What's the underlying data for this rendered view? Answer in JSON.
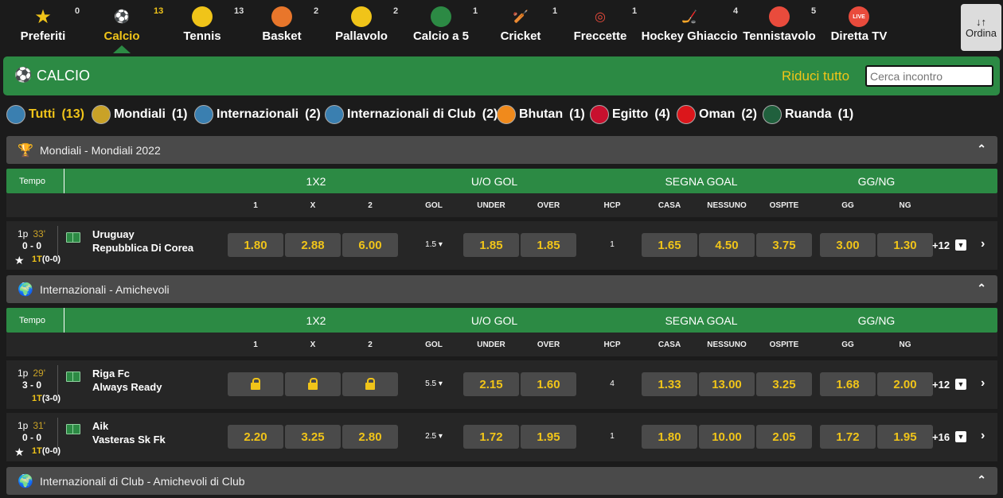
{
  "nav": {
    "sports": [
      {
        "label": "Preferiti",
        "count": "0",
        "icon": "star-icon",
        "color": "#f0c419",
        "glyph": "★"
      },
      {
        "label": "Calcio",
        "count": "13",
        "icon": "soccer-ball-icon",
        "color": "#ffffff",
        "glyph": "⚽"
      },
      {
        "label": "Tennis",
        "count": "13",
        "icon": "tennis-ball-icon",
        "color": "#f0c419",
        "glyph": ""
      },
      {
        "label": "Basket",
        "count": "2",
        "icon": "basketball-icon",
        "color": "#e8762b",
        "glyph": ""
      },
      {
        "label": "Pallavolo",
        "count": "2",
        "icon": "volleyball-icon",
        "color": "#f0c419",
        "glyph": ""
      },
      {
        "label": "Calcio a 5",
        "count": "1",
        "icon": "futsal-ball-icon",
        "color": "#2c8a44",
        "glyph": ""
      },
      {
        "label": "Cricket",
        "count": "1",
        "icon": "cricket-bat-icon",
        "color": "#1b1b1b",
        "glyph": "🏏"
      },
      {
        "label": "Freccette",
        "count": "1",
        "icon": "dart-target-icon",
        "color": "#e94b3c",
        "glyph": "◎"
      },
      {
        "label": "Hockey Ghiaccio",
        "count": "4",
        "icon": "hockey-stick-icon",
        "color": "#1b1b1b",
        "glyph": "🏒"
      },
      {
        "label": "Tennistavolo",
        "count": "5",
        "icon": "ping-pong-icon",
        "color": "#e94b3c",
        "glyph": ""
      },
      {
        "label": "Diretta TV",
        "count": "",
        "icon": "live-tv-icon",
        "color": "#e94b3c",
        "glyph": "LIVE"
      }
    ],
    "ordina_label": "Ordina",
    "ordina_arrows": "↓↑"
  },
  "header": {
    "title": "CALCIO",
    "riduci": "Riduci tutto",
    "search_placeholder": "Cerca incontro"
  },
  "filters": [
    {
      "label": "Tutti",
      "count": "(13)",
      "icon": "globe-icon",
      "color": "#3a7fb0"
    },
    {
      "label": "Mondiali",
      "count": "(1)",
      "icon": "trophy-icon",
      "color": "#c9a227"
    },
    {
      "label": "Internazionali",
      "count": "(2)",
      "icon": "globe-icon",
      "color": "#3a7fb0"
    },
    {
      "label": "Internazionali di Club",
      "count": "(2)",
      "icon": "globe-icon",
      "color": "#3a7fb0"
    },
    {
      "label": "Bhutan",
      "count": "(1)",
      "icon": "bhutan-flag-icon",
      "color": "#f08a1c"
    },
    {
      "label": "Egitto",
      "count": "(4)",
      "icon": "egypt-flag-icon",
      "color": "#c8102e"
    },
    {
      "label": "Oman",
      "count": "(2)",
      "icon": "oman-flag-icon",
      "color": "#db161b"
    },
    {
      "label": "Ruanda",
      "count": "(1)",
      "icon": "rwanda-flag-icon",
      "color": "#20603d"
    }
  ],
  "market_header": {
    "tempo": "Tempo",
    "groups": [
      "1X2",
      "U/O GOL",
      "SEGNA GOAL",
      "GG/NG"
    ],
    "cols": [
      "1",
      "X",
      "2",
      "GOL",
      "UNDER",
      "OVER",
      "HCP",
      "CASA",
      "NESSUNO",
      "OSPITE",
      "GG",
      "NG"
    ]
  },
  "sections": [
    {
      "title": "Mondiali - Mondiali 2022",
      "icon": "trophy-icon"
    },
    {
      "title": "Internazionali - Amichevoli",
      "icon": "globe-icon"
    },
    {
      "title": "Internazionali di Club - Amichevoli di Club",
      "icon": "globe-icon"
    }
  ],
  "matches": [
    {
      "period": "1p",
      "minute": "33'",
      "score": "0 - 0",
      "half": "1T",
      "half_score": "(0-0)",
      "home": "Uruguay",
      "away": "Repubblica Di Corea",
      "odds": [
        "1.80",
        "2.88",
        "6.00"
      ],
      "gol": "1.5",
      "uo": [
        "1.85",
        "1.85"
      ],
      "hcp": "1",
      "segna": [
        "1.65",
        "4.50",
        "3.75"
      ],
      "ggng": [
        "3.00",
        "1.30"
      ],
      "more": "+12",
      "star": true
    },
    {
      "period": "1p",
      "minute": "29'",
      "score": "3 - 0",
      "half": "1T",
      "half_score": "(3-0)",
      "home": "Riga Fc",
      "away": "Always Ready",
      "odds": [
        "locked",
        "locked",
        "locked"
      ],
      "gol": "5.5",
      "uo": [
        "2.15",
        "1.60"
      ],
      "hcp": "4",
      "segna": [
        "1.33",
        "13.00",
        "3.25"
      ],
      "ggng": [
        "1.68",
        "2.00"
      ],
      "more": "+12",
      "star": false
    },
    {
      "period": "1p",
      "minute": "31'",
      "score": "0 - 0",
      "half": "1T",
      "half_score": "(0-0)",
      "home": "Aik",
      "away": "Vasteras Sk Fk",
      "odds": [
        "2.20",
        "3.25",
        "2.80"
      ],
      "gol": "2.5",
      "uo": [
        "1.72",
        "1.95"
      ],
      "hcp": "1",
      "segna": [
        "1.80",
        "10.00",
        "2.05"
      ],
      "ggng": [
        "1.72",
        "1.95"
      ],
      "more": "+16",
      "star": true
    }
  ]
}
